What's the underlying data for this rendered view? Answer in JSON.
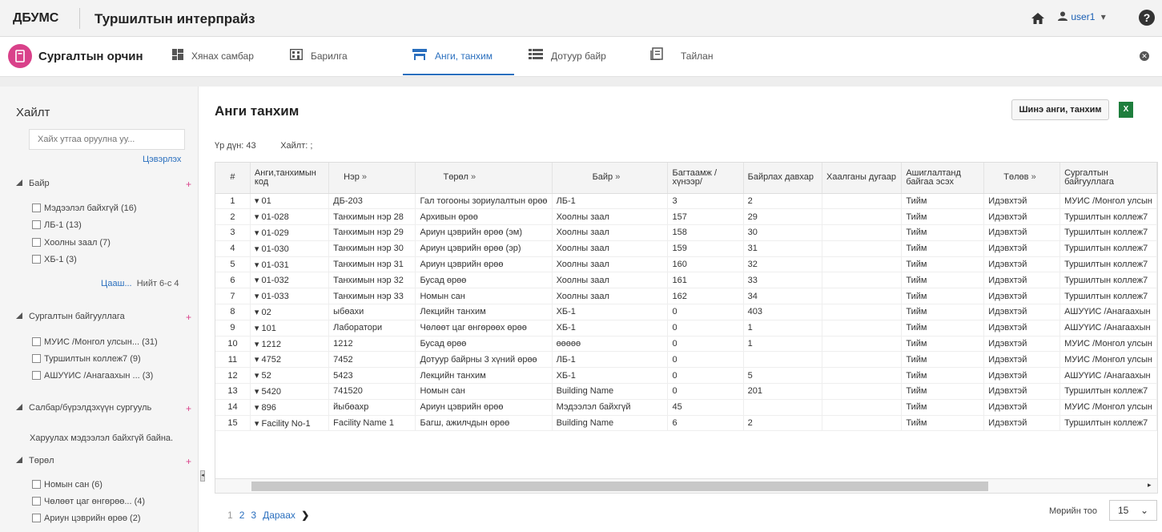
{
  "header": {
    "brand": "ДБУМС",
    "org": "Туршилтын интерпрайз",
    "user": "user1"
  },
  "nav": {
    "app_title": "Сургалтын орчин",
    "items": [
      "Хянах самбар",
      "Барилга",
      "Анги, танхим",
      "Дотуур байр",
      "Тайлан"
    ],
    "active": "Анги, танхим"
  },
  "sidebar": {
    "title": "Хайлт",
    "search_placeholder": "Хайх утгаа оруулна уу...",
    "clear": "Цэвэрлэх",
    "sections": [
      {
        "title": "Байр",
        "items": [
          "Мэдээлэл байхгүй (16)",
          "ЛБ-1 (13)",
          "Хоолны заал (7)",
          "ХБ-1 (3)"
        ],
        "more_link": "Цааш...",
        "more_text": "Нийт 6-с 4"
      },
      {
        "title": "Сургалтын байгууллага",
        "items": [
          "МУИС /Монгол улсын... (31)",
          "Туршилтын коллеж7 (9)",
          "АШУҮИС /Анагаахын ... (3)"
        ]
      },
      {
        "title": "Салбар/бүрэлдэхүүн сургууль",
        "empty": "Харуулах мэдээлэл байхгүй байна."
      },
      {
        "title": "Төрөл",
        "items": [
          "Номын сан (6)",
          "Чөлөөт цаг өнгөрөө... (4)",
          "Ариун цэврийн өрөө (2)"
        ]
      }
    ]
  },
  "main": {
    "title": "Анги танхим",
    "new_button": "Шинэ анги, танхим",
    "summary": "Үр дүн: 43",
    "search_label": "Хайлт: ;",
    "columns": [
      "#",
      "Анги,танхимын код",
      "Нэр",
      "Төрөл",
      "Байр",
      "Багтаамж / хүнээр/",
      "Байрлах давхар",
      "Хаалганы дугаар",
      "Ашиглалтанд байгаа эсэх",
      "Төлөв",
      "Сургалтын байгууллага"
    ],
    "rows": [
      [
        "1",
        "01",
        "ДБ-203",
        "Гал тогооны зориулалтын өрөө",
        "ЛБ-1",
        "3",
        "2",
        "",
        "Тийм",
        "Идэвхтэй",
        "МУИС /Монгол улсын"
      ],
      [
        "2",
        "01-028",
        "Танхимын нэр 28",
        "Архивын өрөө",
        "Хоолны заал",
        "157",
        "29",
        "",
        "Тийм",
        "Идэвхтэй",
        "Туршилтын коллеж7"
      ],
      [
        "3",
        "01-029",
        "Танхимын нэр 29",
        "Ариун цэврийн өрөө (эм)",
        "Хоолны заал",
        "158",
        "30",
        "",
        "Тийм",
        "Идэвхтэй",
        "Туршилтын коллеж7"
      ],
      [
        "4",
        "01-030",
        "Танхимын нэр 30",
        "Ариун цэврийн өрөө (эр)",
        "Хоолны заал",
        "159",
        "31",
        "",
        "Тийм",
        "Идэвхтэй",
        "Туршилтын коллеж7"
      ],
      [
        "5",
        "01-031",
        "Танхимын нэр 31",
        "Ариун цэврийн өрөө",
        "Хоолны заал",
        "160",
        "32",
        "",
        "Тийм",
        "Идэвхтэй",
        "Туршилтын коллеж7"
      ],
      [
        "6",
        "01-032",
        "Танхимын нэр 32",
        "Бусад өрөө",
        "Хоолны заал",
        "161",
        "33",
        "",
        "Тийм",
        "Идэвхтэй",
        "Туршилтын коллеж7"
      ],
      [
        "7",
        "01-033",
        "Танхимын нэр 33",
        "Номын сан",
        "Хоолны заал",
        "162",
        "34",
        "",
        "Тийм",
        "Идэвхтэй",
        "Туршилтын коллеж7"
      ],
      [
        "8",
        "02",
        "ыбөахи",
        "Лекцийн танхим",
        "ХБ-1",
        "0",
        "403",
        "",
        "Тийм",
        "Идэвхтэй",
        "АШУҮИС /Анагаахын"
      ],
      [
        "9",
        "101",
        "Лаборатори",
        "Чөлөөт цаг өнгөрөөх өрөө",
        "ХБ-1",
        "0",
        "1",
        "",
        "Тийм",
        "Идэвхтэй",
        "АШУҮИС /Анагаахын"
      ],
      [
        "10",
        "1212",
        "1212",
        "Бусад өрөө",
        "өөөөө",
        "0",
        "1",
        "",
        "Тийм",
        "Идэвхтэй",
        "МУИС /Монгол улсын"
      ],
      [
        "11",
        "4752",
        "7452",
        "Дотуур байрны 3 хүний өрөө",
        "ЛБ-1",
        "0",
        "",
        "",
        "Тийм",
        "Идэвхтэй",
        "МУИС /Монгол улсын"
      ],
      [
        "12",
        "52",
        "5423",
        "Лекцийн танхим",
        "ХБ-1",
        "0",
        "5",
        "",
        "Тийм",
        "Идэвхтэй",
        "АШУҮИС /Анагаахын"
      ],
      [
        "13",
        "5420",
        "741520",
        "Номын сан",
        "Building Name",
        "0",
        "201",
        "",
        "Тийм",
        "Идэвхтэй",
        "Туршилтын коллеж7"
      ],
      [
        "14",
        "896",
        "йыбөахр",
        "Ариун цэврийн өрөө",
        "Мэдээлэл байхгүй",
        "45",
        "",
        "",
        "Тийм",
        "Идэвхтэй",
        "МУИС /Монгол улсын"
      ],
      [
        "15",
        "Facility No-1",
        "Facility Name 1",
        "Багш, ажилчдын өрөө",
        "Building Name",
        "6",
        "2",
        "",
        "Тийм",
        "Идэвхтэй",
        "Туршилтын коллеж7"
      ]
    ],
    "pages": [
      "1",
      "2",
      "3"
    ],
    "next": "Дараах",
    "rows_per_page_label": "Мөрийн тоо",
    "rows_per_page": "15"
  },
  "icons": {
    "home": "home-icon",
    "user": "user-icon",
    "help": "help-icon",
    "excel": "excel-icon"
  },
  "colors": {
    "accent": "#2a6fbe",
    "brand_pink": "#d9418a",
    "excel_green": "#1e7e3d"
  }
}
